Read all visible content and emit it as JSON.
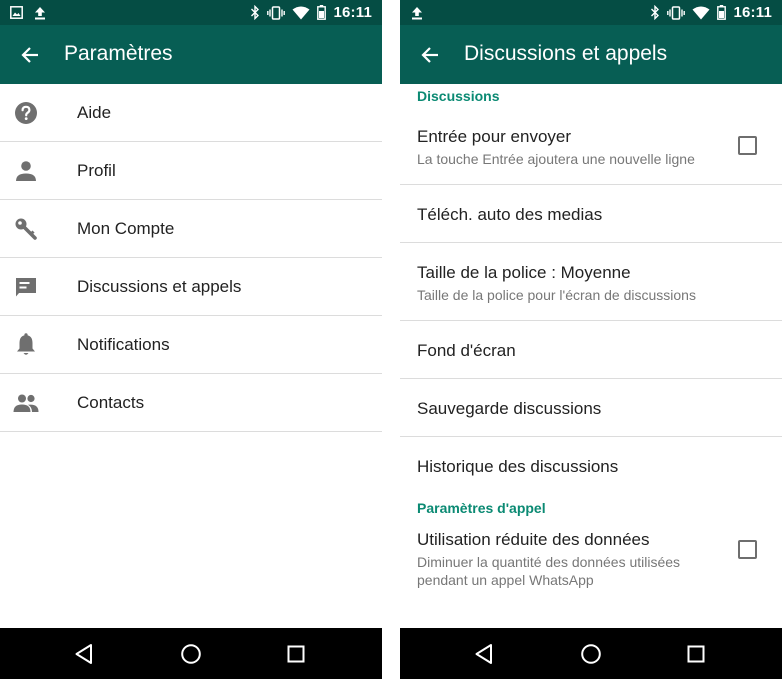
{
  "status_bar": {
    "time": "16:11",
    "left_icons": [
      "image-notification-icon",
      "upload-icon"
    ],
    "right_icons": [
      "bluetooth-icon",
      "vibrate-icon",
      "wifi-icon",
      "battery-icon"
    ]
  },
  "left_screen": {
    "title": "Paramètres",
    "items": [
      {
        "label": "Aide",
        "icon": "help-icon"
      },
      {
        "label": "Profil",
        "icon": "person-icon"
      },
      {
        "label": "Mon Compte",
        "icon": "key-icon"
      },
      {
        "label": "Discussions et appels",
        "icon": "chat-icon"
      },
      {
        "label": "Notifications",
        "icon": "bell-icon"
      },
      {
        "label": "Contacts",
        "icon": "group-icon"
      }
    ]
  },
  "right_screen": {
    "title": "Discussions et appels",
    "section_discussions": "Discussions",
    "items": [
      {
        "title": "Entrée pour envoyer",
        "subtitle": "La touche Entrée ajoutera une nouvelle ligne",
        "checked": false
      },
      {
        "title": "Téléch. auto des medias"
      },
      {
        "title": "Taille de la police : Moyenne",
        "subtitle": "Taille de la police pour l'écran de discussions"
      },
      {
        "title": "Fond d'écran"
      },
      {
        "title": "Sauvegarde discussions"
      },
      {
        "title": "Historique des discussions"
      }
    ],
    "section_calls": "Paramètres d'appel",
    "call_item": {
      "title": "Utilisation réduite des données",
      "subtitle_line1": "Diminuer la quantité des données utilisées",
      "subtitle_line2": "pendant un appel WhatsApp",
      "checked": false
    }
  },
  "nav_bar": {
    "buttons": [
      "back-triangle-icon",
      "home-circle-icon",
      "recents-square-icon"
    ]
  },
  "colors": {
    "status_bar": "#054d44",
    "app_bar": "#075e54",
    "accent": "#0b8a73",
    "nav_bar": "#000000"
  }
}
